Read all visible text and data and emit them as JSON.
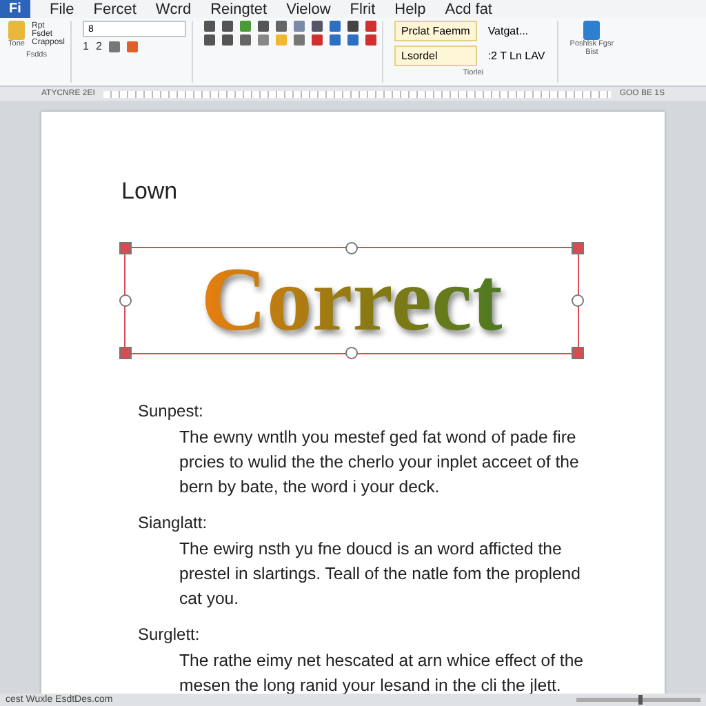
{
  "menu_bar": {
    "app_tab": "Fi",
    "items": [
      "File",
      "Fercet",
      "Wcrd",
      "Reingtet",
      "Vielow",
      "Flrit",
      "Help",
      "Acd fat"
    ]
  },
  "ribbon": {
    "clipboard": {
      "paste_label": "Tone",
      "items": [
        "Rpt",
        "Fsdet",
        "Crapposl"
      ],
      "group_label": "Fsdds"
    },
    "font": {
      "font_size": "8",
      "numbers": [
        "1",
        "2"
      ]
    },
    "styles": {
      "items": [
        {
          "label": "Prclat Faemm",
          "selected": true
        },
        {
          "label": "Vatgat...",
          "selected": false
        },
        {
          "label": "Lsordel",
          "selected": true
        },
        {
          "label": ":2 T Ln LAV",
          "selected": false
        }
      ],
      "group_label": "Tiorlei"
    },
    "publish": {
      "label": "Poshlsk Fgsr Bist"
    }
  },
  "ruler": {
    "left": "ATYCNRE 2EI",
    "right": "GOO BE 1S"
  },
  "document": {
    "heading": "Lown",
    "word_art": "Correct",
    "sections": [
      {
        "title": "Sunpest:",
        "body": "The ewny wntlh you mestef ged fat wond of pade fire prcies to wulid the the cherlo your inplet acceet of the bern by bate, the word i your deck."
      },
      {
        "title": "Sianglatt:",
        "body": "The ewirg nsth yu fne doucd is an word afficted the prestel in slartings. Teall of the natle fom the proplend cat you."
      },
      {
        "title": "Surglett:",
        "body": "The rathe eimy net hescated at arn whice effect of the mesen the long ranid your lesand in the cli the jlett."
      }
    ]
  },
  "status_bar": {
    "text": "cest Wuxle EsdtDes.com",
    "zoom": {
      "level": 0.5
    }
  }
}
